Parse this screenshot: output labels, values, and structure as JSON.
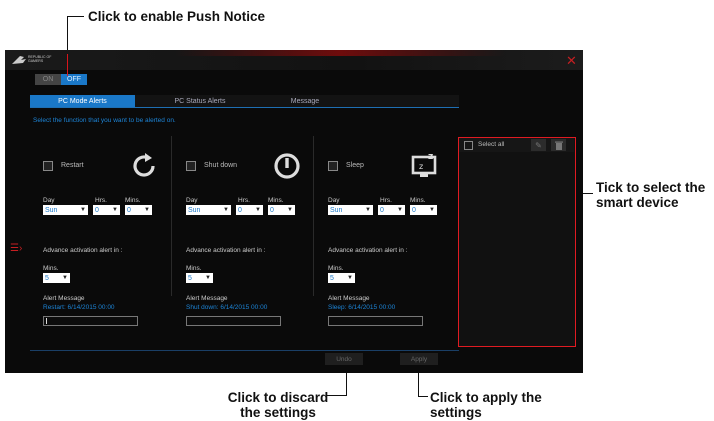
{
  "callouts": {
    "push": "Click to enable Push Notice",
    "tick_line1": "Tick to select the",
    "tick_line2": "smart device",
    "discard_line1": "Click to discard",
    "discard_line2": "the settings",
    "apply_line1": "Click to apply the",
    "apply_line2": "settings"
  },
  "app": {
    "logo_line1": "REPUBLIC OF",
    "logo_line2": "GAMERS",
    "close_icon": "close-icon",
    "toggle": {
      "on": "ON",
      "off": "OFF"
    },
    "tabs": [
      "PC Mode Alerts",
      "PC Status Alerts",
      "Message"
    ],
    "description": "Select the function that you want to be alerted on.",
    "day_label": "Day",
    "hrs_label": "Hrs.",
    "mins_label": "Mins.",
    "advance_label": "Advance activation alert in :",
    "alert_message_label": "Alert Message",
    "columns": [
      {
        "label": "Restart",
        "icon": "restart-icon",
        "day": "Sun",
        "hrs": "0",
        "mins": "0",
        "advance_mins": "5",
        "message": "Restart: 6/14/2015 00:00"
      },
      {
        "label": "Shut down",
        "icon": "power-icon",
        "day": "Sun",
        "hrs": "0",
        "mins": "0",
        "advance_mins": "5",
        "message": "Shut down: 6/14/2015 00:00"
      },
      {
        "label": "Sleep",
        "icon": "sleep-icon",
        "day": "Sun",
        "hrs": "0",
        "mins": "0",
        "advance_mins": "5",
        "message": "Sleep: 6/14/2015 00:00"
      }
    ],
    "buttons": {
      "undo": "Undo",
      "apply": "Apply"
    },
    "device_panel": {
      "select_all": "Select all",
      "edit_icon": "edit-icon",
      "delete_icon": "trash-icon"
    },
    "colors": {
      "accent_blue": "#1a78c8",
      "rog_red": "#d8151c",
      "background": "#0a0a0a"
    }
  }
}
